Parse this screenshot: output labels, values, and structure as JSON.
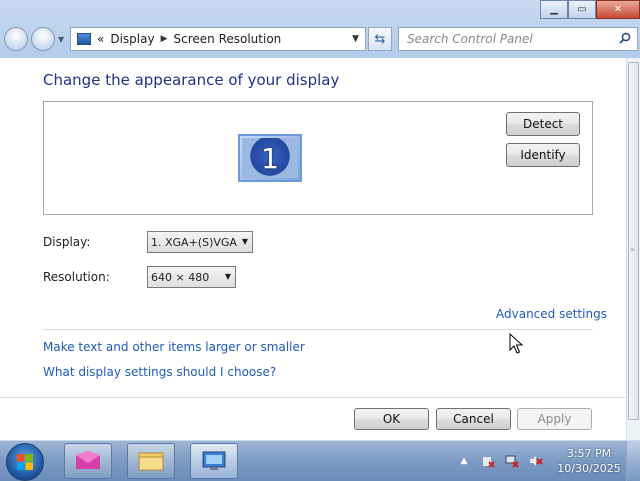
{
  "window": {
    "caption_buttons": [
      "minimize",
      "maximize",
      "close"
    ]
  },
  "address": {
    "overflow_chevron": "«",
    "crumbs": [
      "Display",
      "Screen Resolution"
    ],
    "search_placeholder": "Search Control Panel"
  },
  "main": {
    "title": "Change the appearance of your display",
    "monitor_number": "1",
    "detect_label": "Detect",
    "identify_label": "Identify",
    "display_label": "Display:",
    "display_value": "1. XGA+(S)VGA",
    "resolution_label": "Resolution:",
    "resolution_value": "640 × 480",
    "advanced_link": "Advanced settings",
    "link_text_size": "Make text and other items larger or smaller",
    "link_display_help": "What display settings should I choose?",
    "ok_label": "OK",
    "cancel_label": "Cancel",
    "apply_label": "Apply"
  },
  "taskbar": {
    "apps": [
      "start-orb",
      "media-app",
      "file-explorer",
      "control-panel"
    ],
    "clock_time": "3:57 PM",
    "clock_date": "10/30/2025"
  },
  "colors": {
    "title": "#1e3287",
    "link": "#1f5cb8",
    "taskbar": "#7d9bc4"
  }
}
